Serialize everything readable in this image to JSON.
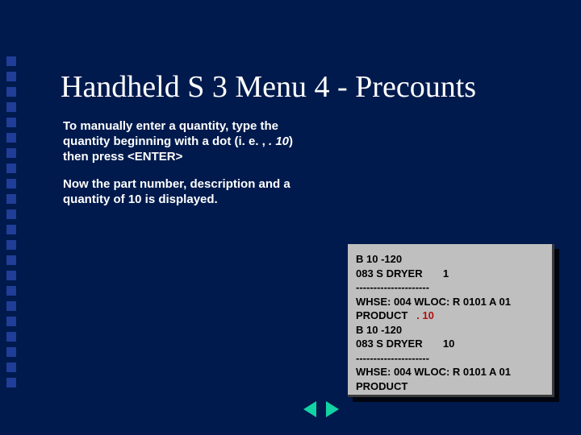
{
  "title": "Handheld S 3 Menu 4 - Precounts",
  "body": {
    "p1a": "To manually enter a quantity, type the quantity beginning with a dot (i. e. , ",
    "p1_em": ". 10",
    "p1b": ") then press <ENTER>",
    "p2": "Now the part number, description and a quantity of 10 is displayed."
  },
  "terminal": {
    "l1": "B 10 -120",
    "l2": "083 S DRYER       1",
    "l3": "---------------------",
    "l4": "WHSE: 004 WLOC: R 0101 A 01",
    "l5a": "PRODUCT   ",
    "l5_input": ". 10",
    "l6": "B 10 -120",
    "l7": "083 S DRYER       10",
    "l8": "---------------------",
    "l9": "WHSE: 004 WLOC: R 0101 A 01",
    "l10": "PRODUCT"
  }
}
